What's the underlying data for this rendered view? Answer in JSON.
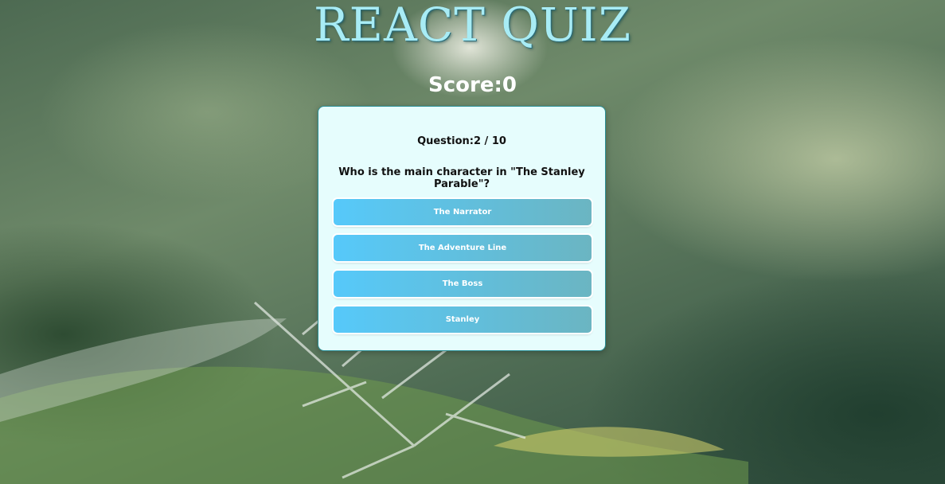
{
  "header": {
    "title": "REACT QUIZ",
    "score_label": "Score:0"
  },
  "quiz": {
    "question_counter": "Question:2 / 10",
    "question_text": "Who is the main character in \"The Stanley Parable\"?",
    "answers": [
      {
        "label": "The Narrator"
      },
      {
        "label": "The Adventure Line"
      },
      {
        "label": "The Boss"
      },
      {
        "label": "Stanley"
      }
    ]
  },
  "colors": {
    "title": "#a8ecf5",
    "card_background": "#e6fdfd",
    "card_border": "#2a8f96",
    "button_gradient_start": "#56c9fa",
    "button_gradient_end": "#6bb5c2"
  }
}
